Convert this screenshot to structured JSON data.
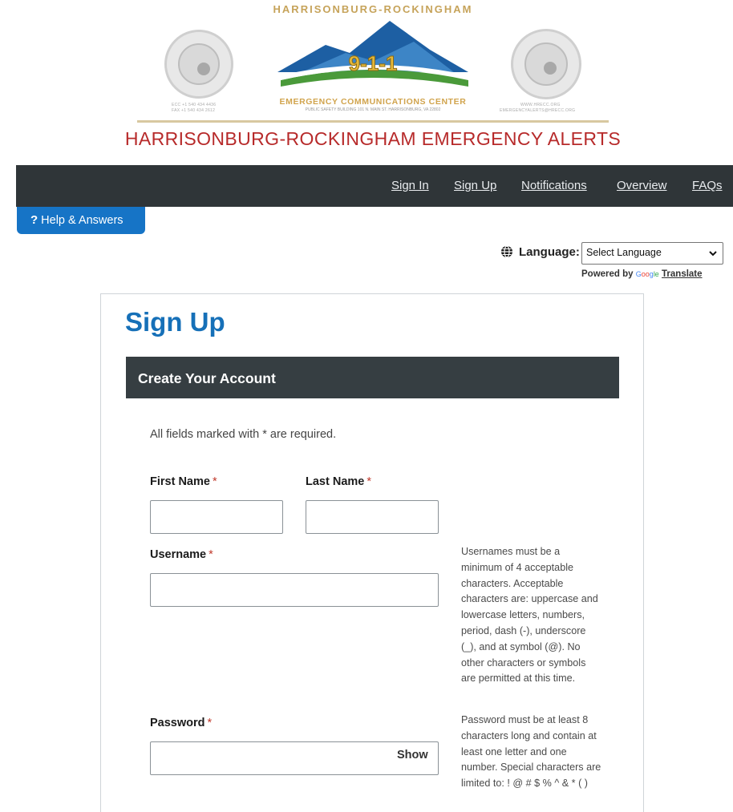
{
  "banner": {
    "left_seal_caption1": "ECC +1 540 434 4436",
    "left_seal_caption2": "FAX +1 540 434 2612",
    "arc_text": "HARRISONBURG-ROCKINGHAM",
    "emblem_text": "9-1-1",
    "center_caption": "EMERGENCY COMMUNICATIONS CENTER",
    "center_subcaption": "PUBLIC SAFETY BUILDING 101 N. MAIN ST. HARRISONBURG, VA 22802",
    "right_seal_caption1": "WWW.HRECC.ORG",
    "right_seal_caption2": "EMERGENCYALERTS@HRECC.ORG",
    "site_title": "HARRISONBURG-ROCKINGHAM EMERGENCY ALERTS",
    "colors": {
      "title_red": "#b72a2a",
      "gold": "#d1a44d",
      "mountain_blue": "#1d5fa3",
      "green": "#4a9a3a"
    }
  },
  "nav": {
    "items": [
      {
        "label": "Sign In"
      },
      {
        "label": "Sign Up"
      },
      {
        "label": "Notifications"
      },
      {
        "label": "Overview"
      },
      {
        "label": "FAQs"
      }
    ]
  },
  "help": {
    "icon": "question-icon",
    "q_glyph": "?",
    "label": "Help & Answers"
  },
  "language": {
    "icon": "globe-icon",
    "label": "Language:",
    "selected": "Select Language",
    "powered_by": "Powered by",
    "google": [
      "G",
      "oo",
      "g",
      "le"
    ],
    "translate": "Translate"
  },
  "form": {
    "page_title": "Sign Up",
    "section_title": "Create Your Account",
    "required_note": "All fields marked with * are required.",
    "required_marker": "*",
    "first_name_label": "First Name",
    "first_name_value": "",
    "last_name_label": "Last Name",
    "last_name_value": "",
    "username_label": "Username",
    "username_value": "",
    "username_hint": "Usernames must be a minimum of 4 acceptable characters. Acceptable characters are: uppercase and lowercase letters, numbers, period, dash (-), underscore (_), and at symbol (@). No other characters or symbols are permitted at this time.",
    "password_label": "Password",
    "password_value": "",
    "show_label": "Show",
    "password_hint": "Password must be at least 8 characters long and contain at least one letter and one number. Special characters are limited to: ! @ # $ % ^ & * ( )"
  }
}
